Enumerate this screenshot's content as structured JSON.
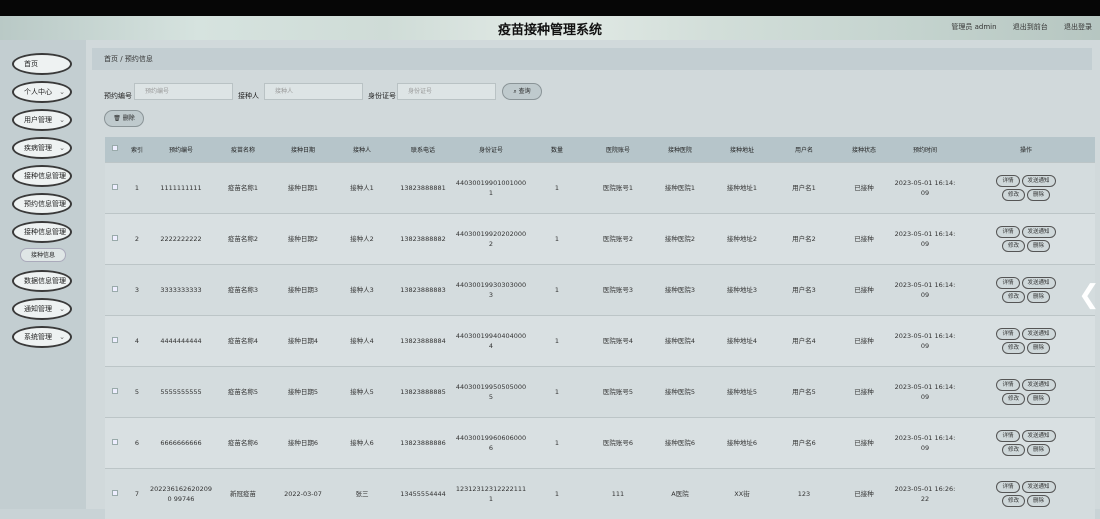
{
  "header": {
    "title": "疫苗接种管理系统",
    "admin": "管理员 admin",
    "exit_front": "退出到前台",
    "logout": "退出登录"
  },
  "sidebar": {
    "items": [
      "首页",
      "个人中心",
      "用户管理",
      "疾病管理",
      "接种信息管理",
      "预约信息管理",
      "接种信息管理",
      "数据信息管理",
      "通知管理",
      "系统管理"
    ],
    "sub": "接种信息"
  },
  "breadcrumb": {
    "home": "首页",
    "sep": "/",
    "current": "预约信息"
  },
  "search": {
    "label1": "预约编号",
    "ph1": "预约编号",
    "label2": "接种人",
    "ph2": "接种人",
    "label3": "身份证号",
    "ph3": "身份证号",
    "btn": "查询",
    "del": "删除"
  },
  "table": {
    "headers": [
      "",
      "索引",
      "预约编号",
      "疫苗名称",
      "接种日期",
      "接种人",
      "联系电话",
      "身份证号",
      "数量",
      "医院账号",
      "接种医院",
      "接种地址",
      "用户名",
      "接种状态",
      "预约时间",
      "操作"
    ],
    "rows": [
      [
        "1",
        "1111111111",
        "疫苗名称1",
        "接种日期1",
        "接种人1",
        "13823888881",
        "440300199010010001",
        "1",
        "医院账号1",
        "接种医院1",
        "接种地址1",
        "用户名1",
        "已接种",
        "2023-05-01 16:14:09"
      ],
      [
        "2",
        "2222222222",
        "疫苗名称2",
        "接种日期2",
        "接种人2",
        "13823888882",
        "440300199202020002",
        "1",
        "医院账号2",
        "接种医院2",
        "接种地址2",
        "用户名2",
        "已接种",
        "2023-05-01 16:14:09"
      ],
      [
        "3",
        "3333333333",
        "疫苗名称3",
        "接种日期3",
        "接种人3",
        "13823888883",
        "440300199303030003",
        "1",
        "医院账号3",
        "接种医院3",
        "接种地址3",
        "用户名3",
        "已接种",
        "2023-05-01 16:14:09"
      ],
      [
        "4",
        "4444444444",
        "疫苗名称4",
        "接种日期4",
        "接种人4",
        "13823888884",
        "440300199404040004",
        "1",
        "医院账号4",
        "接种医院4",
        "接种地址4",
        "用户名4",
        "已接种",
        "2023-05-01 16:14:09"
      ],
      [
        "5",
        "5555555555",
        "疫苗名称5",
        "接种日期5",
        "接种人5",
        "13823888885",
        "440300199505050005",
        "1",
        "医院账号5",
        "接种医院5",
        "接种地址5",
        "用户名5",
        "已接种",
        "2023-05-01 16:14:09"
      ],
      [
        "6",
        "6666666666",
        "疫苗名称6",
        "接种日期6",
        "接种人6",
        "13823888886",
        "440300199606060006",
        "1",
        "医院账号6",
        "接种医院6",
        "接种地址6",
        "用户名6",
        "已接种",
        "2023-05-01 16:14:09"
      ],
      [
        "7",
        "2022361626202090 99746",
        "新冠疫苗",
        "2022-03-07",
        "张三",
        "13455554444",
        "123123123122221111",
        "1",
        "111",
        "A医院",
        "XX街",
        "123",
        "已接种",
        "2023-05-01 16:26:22"
      ]
    ],
    "ops": [
      "详情",
      "发送通知",
      "修改",
      "删除"
    ]
  }
}
